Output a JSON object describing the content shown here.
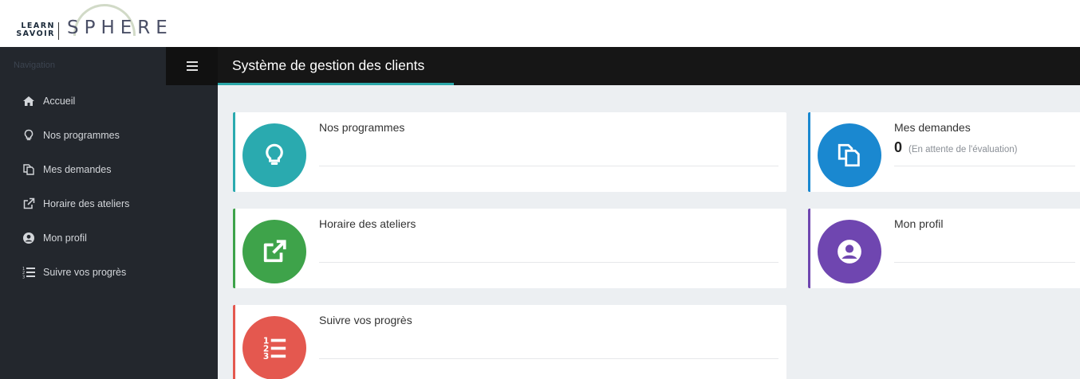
{
  "brand": {
    "line1": "LEARN",
    "line2": "SAVOIR",
    "word": "SPHERE"
  },
  "sidebar": {
    "caption": "Navigation",
    "items": [
      {
        "label": "Accueil",
        "icon": "home-icon"
      },
      {
        "label": "Nos programmes",
        "icon": "lightbulb-icon"
      },
      {
        "label": "Mes demandes",
        "icon": "copy-icon"
      },
      {
        "label": "Horaire des ateliers",
        "icon": "external-link-icon"
      },
      {
        "label": "Mon profil",
        "icon": "user-circle-icon"
      },
      {
        "label": "Suivre vos progrès",
        "icon": "list-ol-icon"
      }
    ]
  },
  "header": {
    "title": "Système de gestion des clients"
  },
  "cards": {
    "programmes": {
      "title": "Nos programmes",
      "color": "#2aaaaf",
      "icon": "lightbulb-icon"
    },
    "demandes": {
      "title": "Mes demandes",
      "count": "0",
      "note": "(En attente de l'évaluation)",
      "color": "#1a88d0",
      "icon": "copy-icon"
    },
    "ateliers": {
      "title": "Horaire des ateliers",
      "color": "#3ea34a",
      "icon": "external-link-icon"
    },
    "profil": {
      "title": "Mon profil",
      "color": "#6f46b0",
      "icon": "user-circle-icon"
    },
    "progres": {
      "title": "Suivre vos progrès",
      "color": "#e4584f",
      "icon": "list-ol-icon"
    }
  }
}
